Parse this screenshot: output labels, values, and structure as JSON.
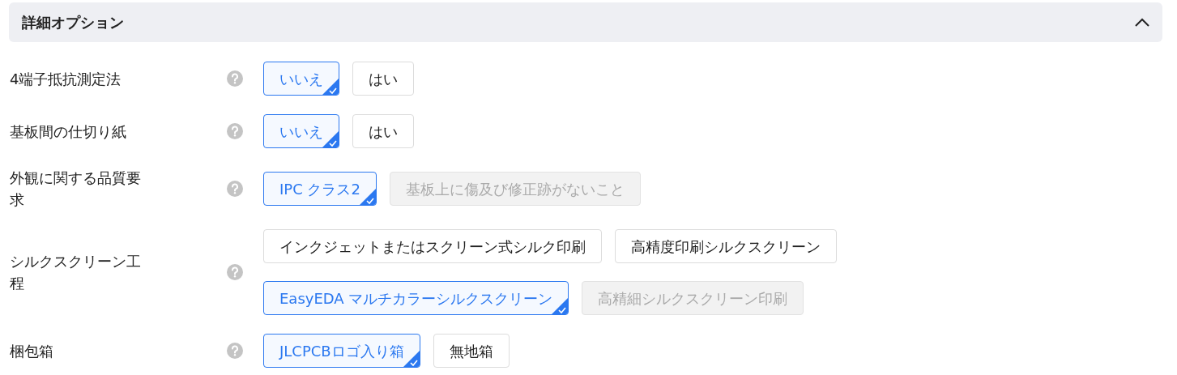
{
  "section": {
    "title": "詳細オプション",
    "expanded": true
  },
  "rows": [
    {
      "label": "4端子抵抗測定法",
      "option_lines": [
        [
          {
            "label": "いいえ",
            "selected": true,
            "disabled": false
          },
          {
            "label": "はい",
            "selected": false,
            "disabled": false
          }
        ]
      ]
    },
    {
      "label": "基板間の仕切り紙",
      "option_lines": [
        [
          {
            "label": "いいえ",
            "selected": true,
            "disabled": false
          },
          {
            "label": "はい",
            "selected": false,
            "disabled": false
          }
        ]
      ]
    },
    {
      "label": "外観に関する品質要求",
      "option_lines": [
        [
          {
            "label": "IPC クラス2",
            "selected": true,
            "disabled": false
          },
          {
            "label": "基板上に傷及び修正跡がないこと",
            "selected": false,
            "disabled": true
          }
        ]
      ]
    },
    {
      "label": "シルクスクリーン工程",
      "option_lines": [
        [
          {
            "label": "インクジェットまたはスクリーン式シルク印刷",
            "selected": false,
            "disabled": false
          },
          {
            "label": "高精度印刷シルクスクリーン",
            "selected": false,
            "disabled": false
          }
        ],
        [
          {
            "label": "EasyEDA マルチカラーシルクスクリーン",
            "selected": true,
            "disabled": false
          },
          {
            "label": "高精細シルクスクリーン印刷",
            "selected": false,
            "disabled": true
          }
        ]
      ]
    },
    {
      "label": "梱包箱",
      "option_lines": [
        [
          {
            "label": "JLCPCBロゴ入り箱",
            "selected": true,
            "disabled": false
          },
          {
            "label": "無地箱",
            "selected": false,
            "disabled": false
          }
        ]
      ]
    }
  ]
}
